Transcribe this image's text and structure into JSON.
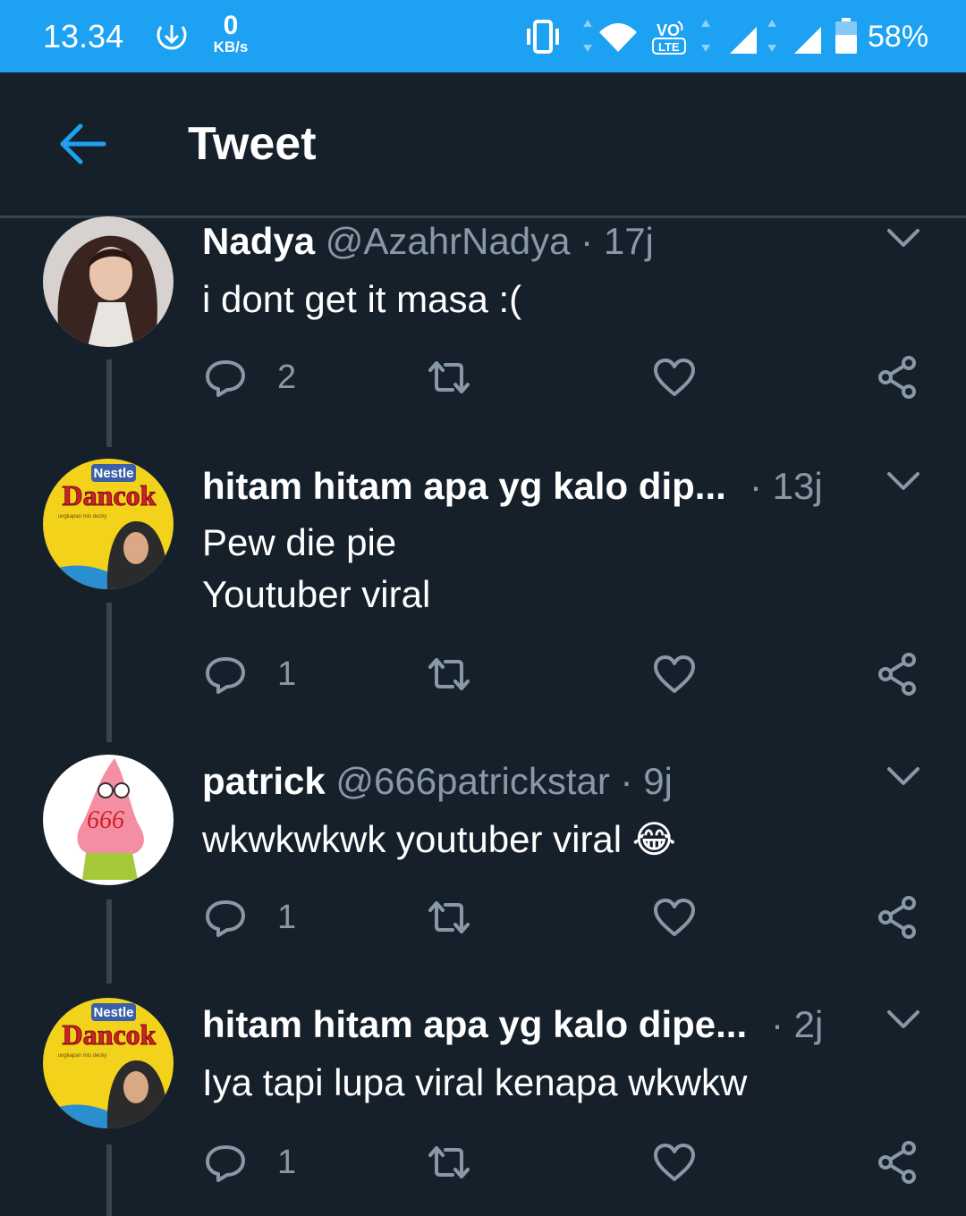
{
  "status_bar": {
    "time": "13.34",
    "net_speed_value": "0",
    "net_speed_unit": "KB/s",
    "battery": "58%",
    "icons": [
      "download-icon",
      "vibrate-icon",
      "wifi-icon",
      "volte-icon",
      "signal-icon",
      "signal-icon",
      "battery-icon"
    ]
  },
  "header": {
    "title": "Tweet",
    "back_icon": "arrow-left-icon"
  },
  "colors": {
    "accent": "#1da1f2",
    "background": "#15202b",
    "secondary_text": "#8899a6",
    "divider": "#38444d"
  },
  "tweets": [
    {
      "name": "Nadya",
      "handle": "@AzahrNadya",
      "sep": "·",
      "time": "17j",
      "lines": [
        "i dont get it masa :("
      ],
      "replies": "2"
    },
    {
      "name": "hitam hitam apa yg kalo dip...",
      "handle": "",
      "sep": "·",
      "time": "13j",
      "lines": [
        "Pew die pie",
        "Youtuber viral"
      ],
      "replies": "1"
    },
    {
      "name": "patrick",
      "handle": "@666patrickstar",
      "sep": "·",
      "time": "9j",
      "lines": [
        "wkwkwkwk youtuber viral"
      ],
      "emoji": "😂",
      "replies": "1"
    },
    {
      "name": "hitam hitam apa yg kalo dipe...",
      "handle": "",
      "sep": "·",
      "time": "2j",
      "lines": [
        "Iya tapi lupa viral kenapa wkwkw"
      ],
      "replies": "1"
    }
  ],
  "avatar_texts": {
    "brand": "Nestle",
    "product": "Dancok",
    "tagline": "ungkapan mis decky",
    "patrick_mark": "666"
  }
}
